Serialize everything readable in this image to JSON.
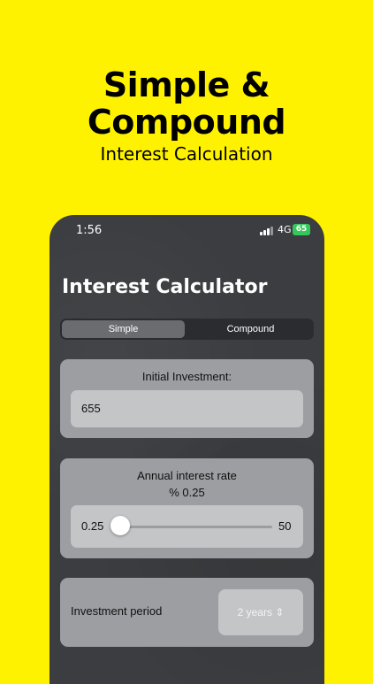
{
  "promo": {
    "headline_line1": "Simple &",
    "headline_line2": "Compound",
    "subheadline": "Interest Calculation"
  },
  "status_bar": {
    "time": "1:56",
    "network": "4G",
    "battery": "65"
  },
  "app": {
    "title": "Interest Calculator",
    "segments": [
      "Simple",
      "Compound"
    ],
    "selected_segment": "Simple",
    "initial_investment": {
      "label": "Initial Investment:",
      "value": "655"
    },
    "interest_rate": {
      "label": "Annual interest rate",
      "display": "% 0.25",
      "min_label": "0.25",
      "max_label": "50",
      "value": 0.25,
      "min": 0.25,
      "max": 50
    },
    "investment_period": {
      "label": "Investment period",
      "selected": "2 years"
    }
  },
  "colors": {
    "background": "#FFF200",
    "phone": "#3b3d40",
    "card": "#9c9ea1",
    "battery": "#34c759"
  }
}
